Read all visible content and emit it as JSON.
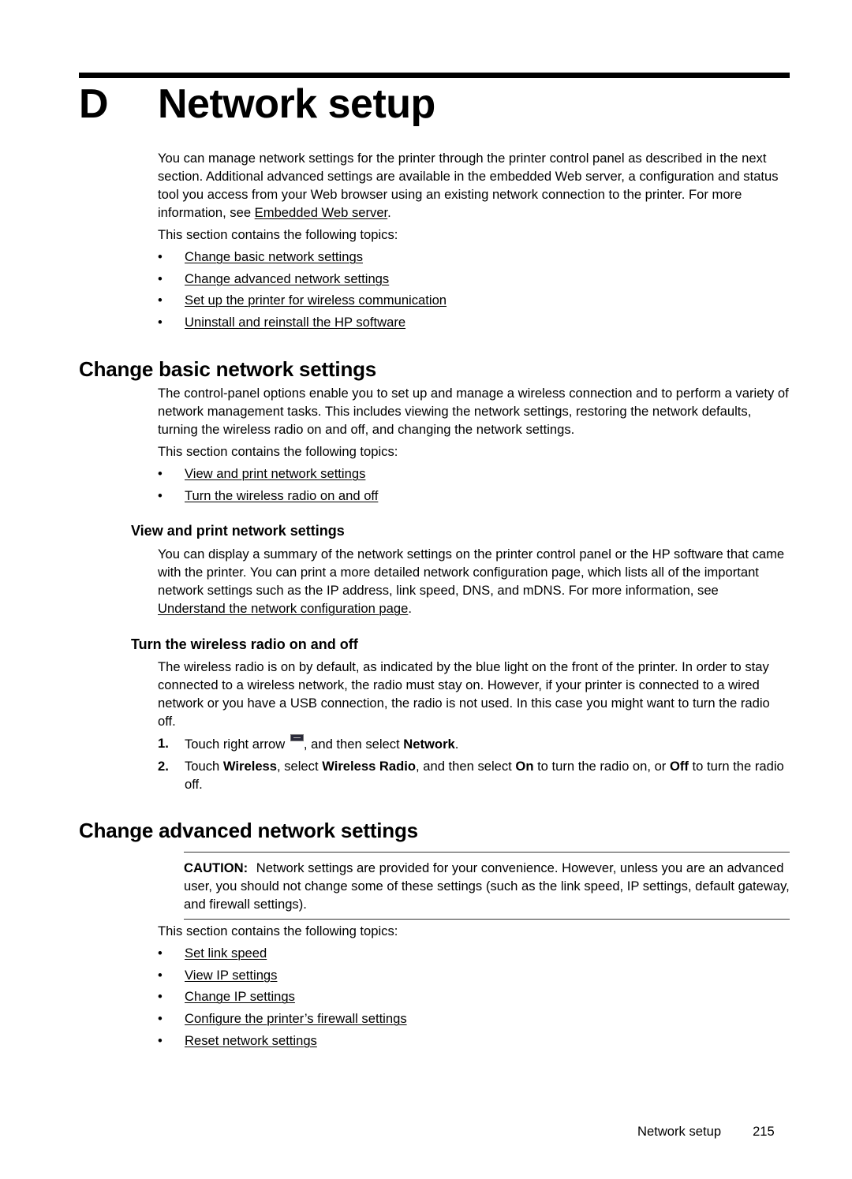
{
  "chapter": {
    "letter": "D",
    "title": "Network setup"
  },
  "intro": {
    "text_before_link": "You can manage network settings for the printer through the printer control panel as described in the next section. Additional advanced settings are available in the embedded Web server, a configuration and status tool you access from your Web browser using an existing network connection to the printer. For more information, see ",
    "link": "Embedded Web server",
    "text_after_link": ".",
    "topics_intro": "This section contains the following topics:",
    "topics": [
      "Change basic network settings",
      "Change advanced network settings",
      "Set up the printer for wireless communication",
      "Uninstall and reinstall the HP software"
    ]
  },
  "basic_settings": {
    "heading": "Change basic network settings",
    "text": "The control-panel options enable you to set up and manage a wireless connection and to perform a variety of network management tasks. This includes viewing the network settings, restoring the network defaults, turning the wireless radio on and off, and changing the network settings.",
    "topics_intro": "This section contains the following topics:",
    "topics": [
      "View and print network settings",
      "Turn the wireless radio on and off"
    ],
    "view_print": {
      "heading": "View and print network settings",
      "text_before_link": "You can display a summary of the network settings on the printer control panel or the HP software that came with the printer. You can print a more detailed network configuration page, which lists all of the important network settings such as the IP address, link speed, DNS, and mDNS. For more information, see ",
      "link": "Understand the network configuration page",
      "text_after_link": "."
    },
    "wireless_radio": {
      "heading": "Turn the wireless radio on and off",
      "text": "The wireless radio is on by default, as indicated by the blue light on the front of the printer. In order to stay connected to a wireless network, the radio must stay on. However, if your printer is connected to a wired network or you have a USB connection, the radio is not used. In this case you might want to turn the radio off.",
      "steps": [
        {
          "num": "1.",
          "part1": "Touch right arrow ",
          "icon": "right-arrow-button-icon",
          "part2": ", and then select ",
          "bold1": "Network",
          "part3": "."
        },
        {
          "num": "2.",
          "part1": "Touch ",
          "bold1": "Wireless",
          "part2": ", select ",
          "bold2": "Wireless Radio",
          "part3": ", and then select ",
          "bold3": "On",
          "part4": " to turn the radio on, or ",
          "bold4": "Off",
          "part5": " to turn the radio off."
        }
      ]
    }
  },
  "advanced_settings": {
    "heading": "Change advanced network settings",
    "caution": {
      "label": "CAUTION:",
      "text": "Network settings are provided for your convenience. However, unless you are an advanced user, you should not change some of these settings (such as the link speed, IP settings, default gateway, and firewall settings)."
    },
    "topics_intro": "This section contains the following topics:",
    "topics": [
      "Set link speed",
      "View IP settings",
      "Change IP settings",
      "Configure the printer’s firewall settings",
      "Reset network settings"
    ]
  },
  "footer": {
    "section": "Network setup",
    "page_number": "215"
  },
  "bullet_char": "•"
}
